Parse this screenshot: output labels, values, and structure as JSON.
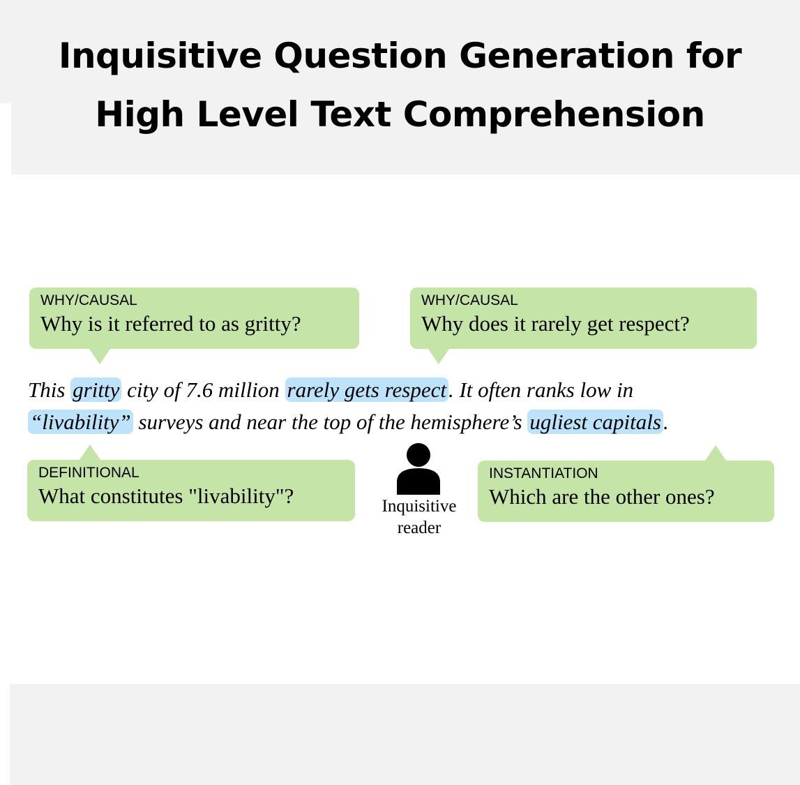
{
  "title": {
    "line1": "Inquisitive Question Generation for",
    "line2": "High Level Text Comprehension"
  },
  "bubbles": {
    "top_left": {
      "tag": "WHY/CAUSAL",
      "question": "Why is it referred to as gritty?"
    },
    "top_right": {
      "tag": "WHY/CAUSAL",
      "question": "Why does it rarely get respect?"
    },
    "bottom_left": {
      "tag": "DEFINITIONAL",
      "question": "What constitutes \"livability\"?"
    },
    "bottom_right": {
      "tag": "INSTANTIATION",
      "question": "Which are the other ones?"
    }
  },
  "passage": {
    "line1": {
      "t1": "This ",
      "h1": "gritty",
      "t2": " city of 7.6 million ",
      "h2": "rarely gets respect",
      "t3": ". It often ranks low in"
    },
    "line2": {
      "h1": "“livability”",
      "t1": " surveys and near the top of the hemisphere’s ",
      "h2": "ugliest capitals",
      "t2": "."
    }
  },
  "reader": {
    "icon": "person-icon",
    "line1": "Inquisitive",
    "line2": "reader"
  },
  "colors": {
    "bubble": "#c5e4a8",
    "highlight": "#bde3fb",
    "band": "#f2f2f2"
  }
}
